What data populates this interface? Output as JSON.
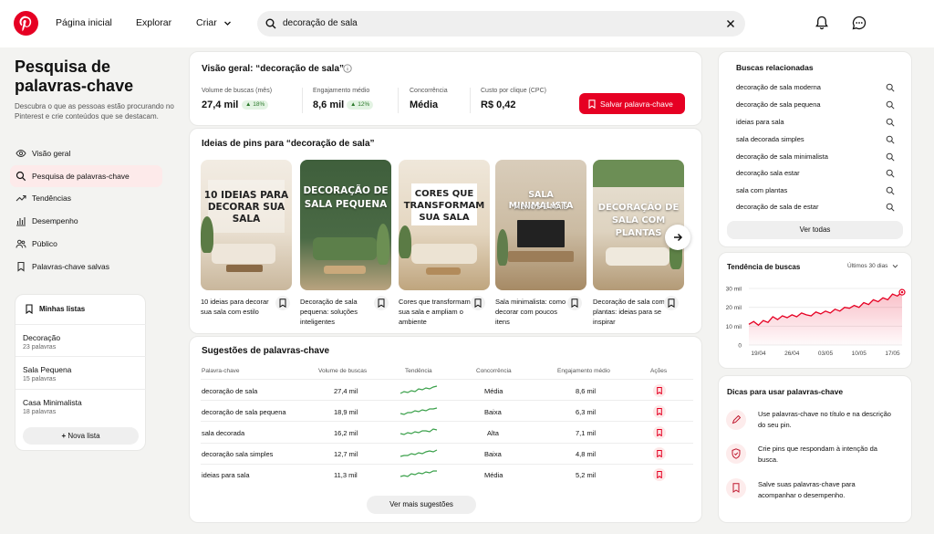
{
  "nav": {
    "home": "Página inicial",
    "explore": "Explorar",
    "create": "Criar",
    "search_value": "decoração de sala"
  },
  "sidebar": {
    "title": "Pesquisa de palavras-chave",
    "description": "Descubra o que as pessoas estão procurando no Pinterest e crie conteúdos que se destacam.",
    "items": [
      {
        "label": "Visão geral",
        "icon": "eye-icon"
      },
      {
        "label": "Pesquisa de palavras-chave",
        "icon": "search-icon"
      },
      {
        "label": "Tendências",
        "icon": "trend-icon"
      },
      {
        "label": "Desempenho",
        "icon": "bar-chart-icon"
      },
      {
        "label": "Público",
        "icon": "people-icon"
      },
      {
        "label": "Palavras-chave salvas",
        "icon": "bookmark-icon"
      }
    ],
    "lists_title": "Minhas listas",
    "lists": [
      {
        "name": "Decoração",
        "count": "23 palavras"
      },
      {
        "name": "Sala Pequena",
        "count": "15 palavras"
      },
      {
        "name": "Casa Minimalista",
        "count": "18 palavras"
      }
    ],
    "new_list": "Nova lista"
  },
  "overview": {
    "title": "Visão geral: “decoração de sala”",
    "metrics": [
      {
        "label": "Volume de buscas (mês)",
        "value": "27,4 mil",
        "badge": "▲ 18%"
      },
      {
        "label": "Engajamento médio",
        "value": "8,6 mil",
        "badge": "▲ 12%"
      },
      {
        "label": "Concorrência",
        "value": "Média"
      },
      {
        "label": "Custo por clique (CPC)",
        "value": "R$ 0,42"
      }
    ],
    "save_label": "Salvar palavra-chave"
  },
  "pins": {
    "title": "Ideias de pins para “decoração de sala”",
    "items": [
      {
        "overlay": "10 IDEIAS PARA DECORAR SUA SALA",
        "caption": "10 ideias para decorar sua sala com estilo"
      },
      {
        "overlay": "DECORAÇÃO DE SALA PEQUENA",
        "caption": "Decoração de sala pequena: soluções inteligentes"
      },
      {
        "overlay": "CORES QUE TRANSFORMAM SUA SALA",
        "caption": "Cores que transformam sua sala e ampliam o ambiente"
      },
      {
        "overlay": "SALA MINIMALISTA",
        "overlay_sub": "MENOS É MAIS",
        "caption": "Sala minimalista: como decorar com poucos itens"
      },
      {
        "overlay": "DECORAÇÃO DE SALA COM PLANTAS",
        "caption": "Decoração de sala com plantas: ideias para se inspirar"
      }
    ]
  },
  "suggestions": {
    "title": "Sugestões de palavras-chave",
    "headers": [
      "Palavra-chave",
      "Volume de buscas",
      "Tendência",
      "Concorrência",
      "Engajamento médio",
      "Ações"
    ],
    "rows": [
      {
        "keyword": "decoração de sala",
        "volume": "27,4 mil",
        "competition": "Média",
        "engagement": "8,6 mil"
      },
      {
        "keyword": "decoração de sala pequena",
        "volume": "18,9 mil",
        "competition": "Baixa",
        "engagement": "6,3 mil"
      },
      {
        "keyword": "sala decorada",
        "volume": "16,2 mil",
        "competition": "Alta",
        "engagement": "7,1 mil"
      },
      {
        "keyword": "decoração sala simples",
        "volume": "12,7 mil",
        "competition": "Baixa",
        "engagement": "4,8 mil"
      },
      {
        "keyword": "ideias para sala",
        "volume": "11,3 mil",
        "competition": "Média",
        "engagement": "5,2 mil"
      }
    ],
    "more_label": "Ver mais sugestões"
  },
  "related": {
    "title": "Buscas relacionadas",
    "items": [
      "decoração de sala moderna",
      "decoração de sala pequena",
      "ideias para sala",
      "sala decorada simples",
      "decoração de sala minimalista",
      "decoração sala estar",
      "sala com plantas",
      "decoração de sala de estar"
    ],
    "see_all": "Ver todas"
  },
  "trend": {
    "title": "Tendência de buscas",
    "period": "Últimos 30 dias",
    "y_ticks": [
      "30 mil",
      "20 mil",
      "10 mil",
      "0"
    ],
    "x_ticks": [
      "19/04",
      "26/04",
      "03/05",
      "10/05",
      "17/05"
    ]
  },
  "chart_data": {
    "type": "area",
    "title": "Tendência de buscas",
    "ylim": [
      0,
      30000
    ],
    "x": [
      "17/04",
      "18/04",
      "19/04",
      "20/04",
      "21/04",
      "22/04",
      "23/04",
      "24/04",
      "25/04",
      "26/04",
      "27/04",
      "28/04",
      "29/04",
      "30/04",
      "01/05",
      "02/05",
      "03/05",
      "04/05",
      "05/05",
      "06/05",
      "07/05",
      "08/05",
      "09/05",
      "10/05",
      "11/05",
      "12/05",
      "13/05",
      "14/05",
      "15/05",
      "16/05",
      "17/05",
      "18/05",
      "19/05"
    ],
    "series": [
      {
        "values": [
          11000,
          12500,
          10500,
          13000,
          12000,
          15000,
          13500,
          15500,
          14500,
          16000,
          15000,
          17000,
          16000,
          15500,
          17500,
          16500,
          18000,
          17000,
          19000,
          18000,
          20000,
          19500,
          21000,
          20000,
          22500,
          21500,
          24000,
          23000,
          25000,
          24000,
          27000,
          26000,
          28000
        ]
      }
    ]
  },
  "tips": {
    "title": "Dicas para usar palavras-chave",
    "items": [
      {
        "text": "Use palavras-chave no título e na descrição do seu pin.",
        "icon": "pencil-icon"
      },
      {
        "text": "Crie pins que respondam à intenção da busca.",
        "icon": "shield-icon"
      },
      {
        "text": "Salve suas palavras-chave para acompanhar o desempenho.",
        "icon": "bookmark-icon"
      }
    ]
  },
  "colors": {
    "accent": "#e60023",
    "positive": "#2c7a2c",
    "sparkline": "#3aa04a"
  }
}
